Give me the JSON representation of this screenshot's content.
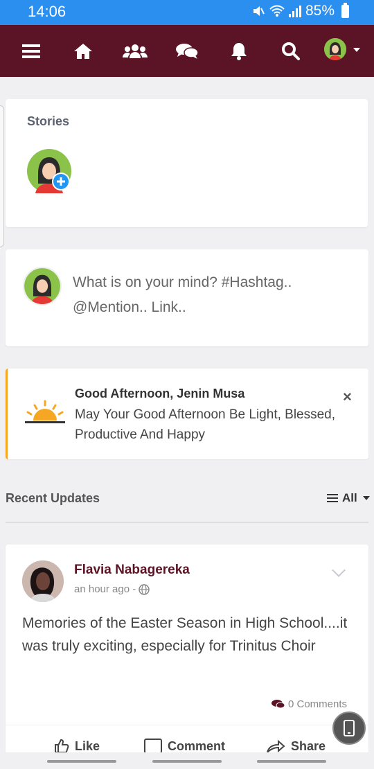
{
  "status": {
    "time": "14:06",
    "battery": "85%"
  },
  "nav": {
    "items": [
      "menu-icon",
      "home-icon",
      "friends-icon",
      "messages-icon",
      "notifications-icon",
      "search-icon"
    ]
  },
  "stories": {
    "title": "Stories"
  },
  "composer": {
    "placeholder": "What is on your mind? #Hashtag.. @Mention.. Link.."
  },
  "greeting": {
    "title": "Good Afternoon, Jenin Musa",
    "message": "May Your Good Afternoon Be Light, Blessed, Productive And Happy",
    "close": "×"
  },
  "updates": {
    "title": "Recent Updates",
    "filter": "All"
  },
  "post": {
    "author": "Flavia Nabagereka",
    "time": "an hour ago -",
    "body": "Memories of the Easter Season in High School....it was truly exciting, especially for Trinitus Choir",
    "comments": "0 Comments",
    "actions": {
      "like": "Like",
      "comment": "Comment",
      "share": "Share"
    }
  },
  "colors": {
    "status_bar": "#2b8ff0",
    "navbar": "#5a1426",
    "accent": "#f5a623",
    "author": "#5a1426"
  }
}
